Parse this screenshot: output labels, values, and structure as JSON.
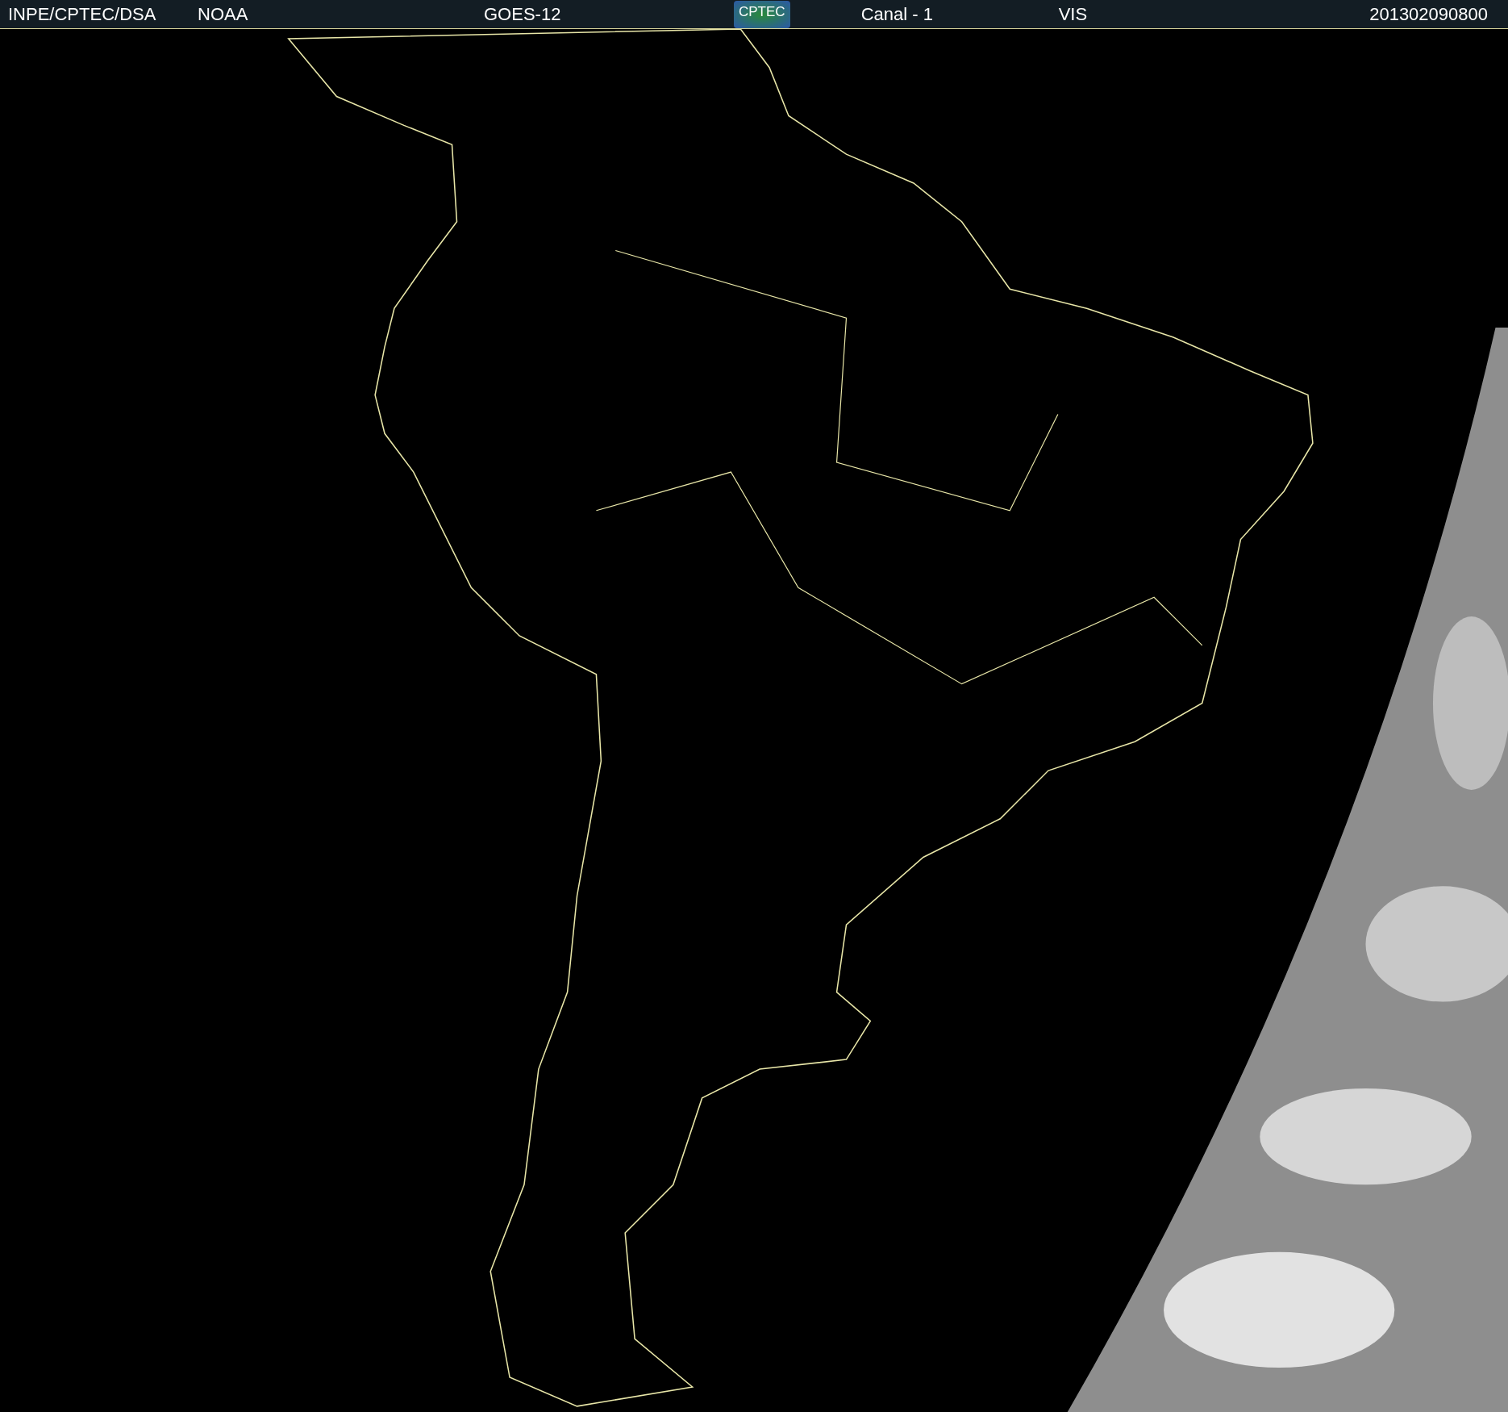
{
  "header": {
    "items": [
      {
        "kind": "text",
        "text": "INPE/CPTEC/DSA"
      },
      {
        "kind": "text",
        "text": "NOAA"
      },
      {
        "kind": "text",
        "text": "GOES-12"
      },
      {
        "kind": "logo",
        "text": "CPTEC"
      },
      {
        "kind": "text",
        "text": "Canal - 1"
      },
      {
        "kind": "text",
        "text": "VIS"
      },
      {
        "kind": "text",
        "text": "201302090800"
      }
    ]
  }
}
